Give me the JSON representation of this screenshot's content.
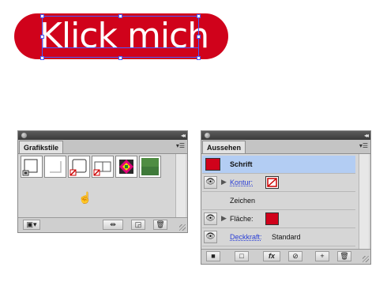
{
  "artwork": {
    "button_text": "Klick mich",
    "fill_color": "#d0021b",
    "selection_color": "#4a5bff"
  },
  "grafikstile": {
    "tab_label": "Grafikstile",
    "swatches": [
      "default-style",
      "no-style",
      "red-slash-style",
      "frame-style",
      "color-burst-style",
      "green-texture-style"
    ]
  },
  "aussehen": {
    "tab_label": "Aussehen",
    "rows": {
      "schrift": "Schrift",
      "kontur": "Kontur:",
      "zeichen": "Zeichen",
      "flaeche": "Fläche:",
      "deckkraft": "Deckkraft:",
      "deckkraft_value": "Standard"
    },
    "footer_buttons": [
      "■",
      "□",
      "fx",
      "⊘",
      "+",
      "🗑"
    ]
  },
  "colors": {
    "panel_bg": "#d6d6d6",
    "selected_row": "#b3cdf3",
    "link": "#2b3fd6"
  }
}
